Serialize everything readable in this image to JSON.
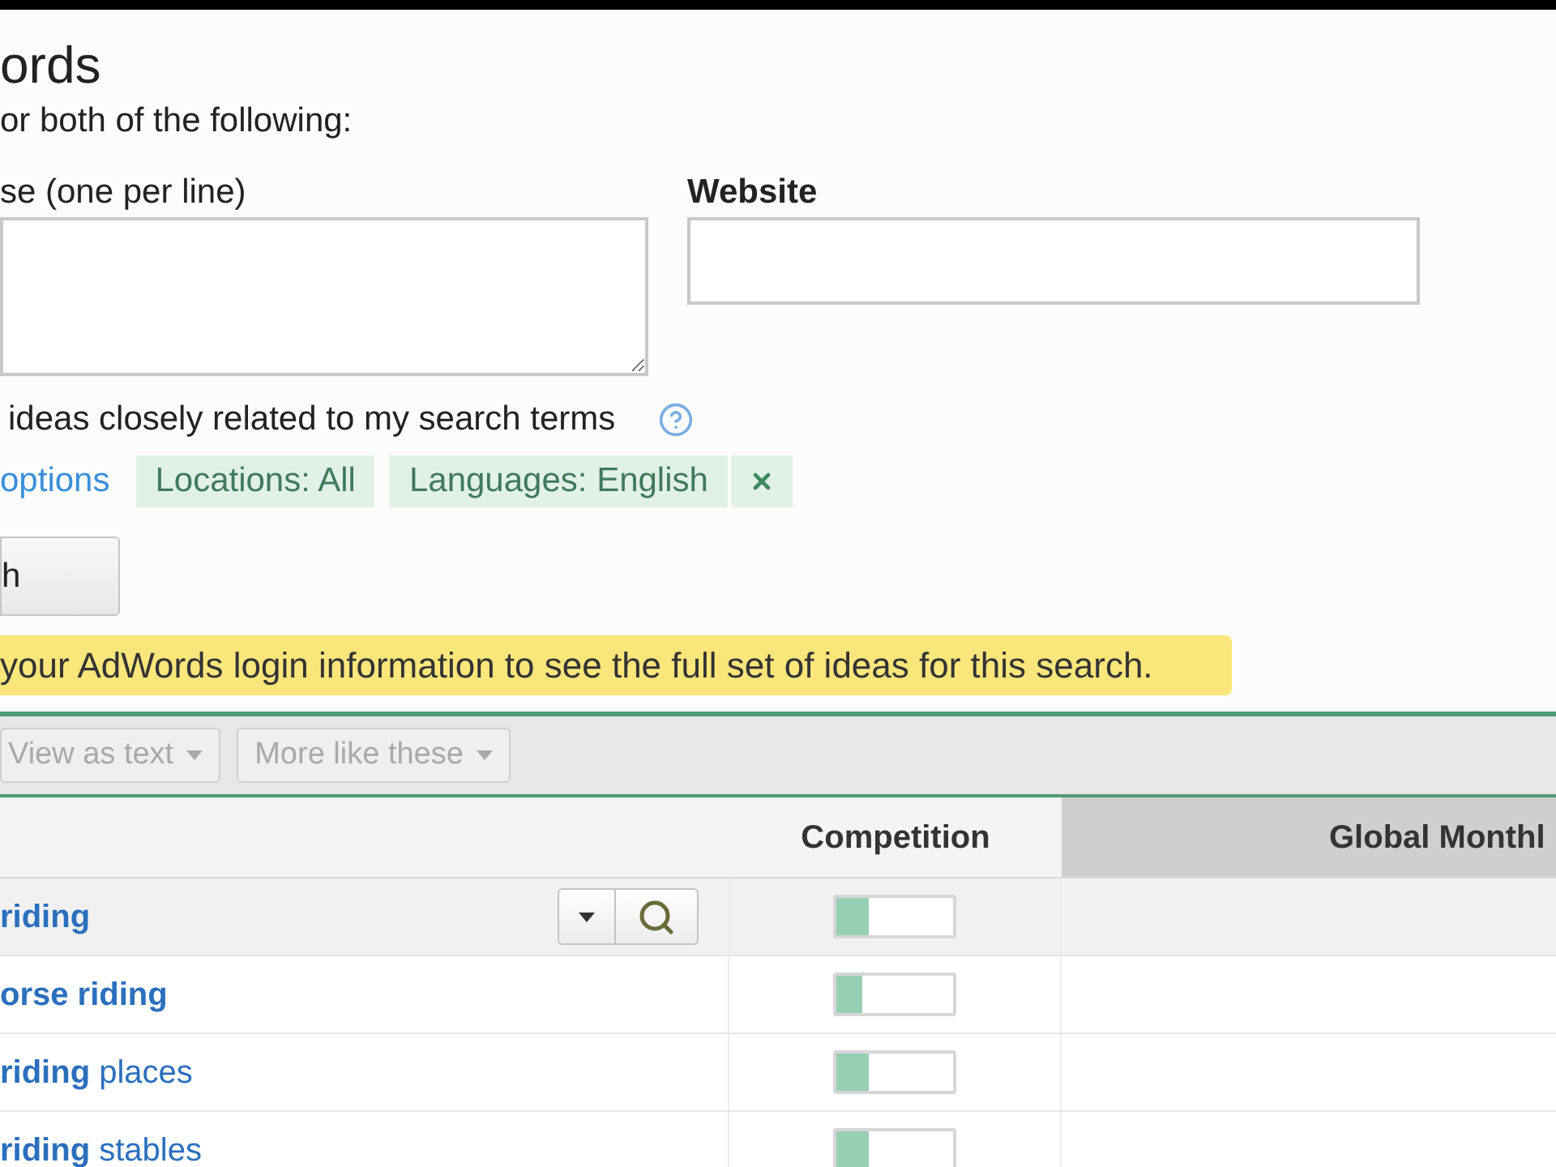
{
  "header": {
    "title": "ords",
    "instruction": "or both of the following:"
  },
  "form": {
    "keywords_label": "se (one per line)",
    "website_label": "Website"
  },
  "related_option": {
    "label": "ideas closely related to my search terms"
  },
  "filters": {
    "link": "options",
    "tags": [
      "Locations: All",
      "Languages: English"
    ],
    "clearable": true
  },
  "search_button": {
    "label": "h"
  },
  "notice": {
    "text": "your AdWords login information to see the full set of ideas for this search."
  },
  "toolbar": {
    "buttons": [
      {
        "label": "View as text",
        "disabled": true
      },
      {
        "label": "More like these",
        "disabled": true
      }
    ]
  },
  "table": {
    "columns": [
      {
        "label": "Competition",
        "sorted": false
      },
      {
        "label": "Global Monthl",
        "sorted": true
      }
    ],
    "rows": [
      {
        "keyword": "riding",
        "exact_match": true,
        "highlighted": true,
        "competition": {
          "level": 0.28
        }
      },
      {
        "keyword": "orse riding",
        "exact_match": true,
        "highlighted": false,
        "competition": {
          "level": 0.22
        }
      },
      {
        "keyword": "**riding** places",
        "exact_match": false,
        "highlighted": false,
        "competition": {
          "level": 0.28
        }
      },
      {
        "keyword": "**riding** stables",
        "exact_match": false,
        "highlighted": false,
        "competition": {
          "level": 0.28
        }
      }
    ]
  }
}
